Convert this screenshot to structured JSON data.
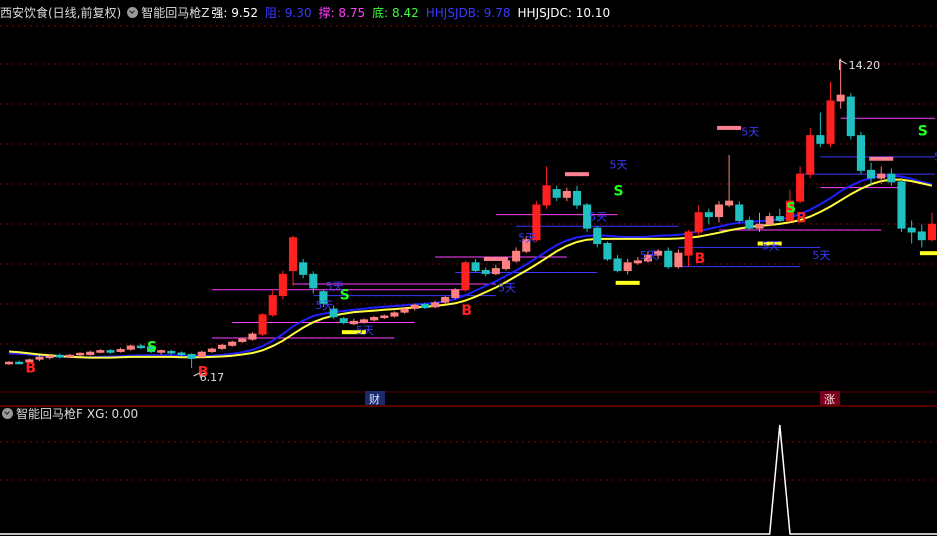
{
  "header_main": {
    "title": "西安饮食(日线,前复权)",
    "indicator": "智能回马枪Z",
    "items": [
      {
        "label": "强:",
        "value": "9.52",
        "color": "#ffffff"
      },
      {
        "label": "阻:",
        "value": "9.30",
        "color": "#3a3aff"
      },
      {
        "label": "撑:",
        "value": "8.75",
        "color": "#ff40ff"
      },
      {
        "label": "底:",
        "value": "8.42",
        "color": "#40ff40"
      },
      {
        "label": "HHJSJDB:",
        "value": "9.78",
        "color": "#3a3aff"
      },
      {
        "label": "HHJSJDC:",
        "value": "10.10",
        "color": "#ffffff"
      }
    ]
  },
  "header_sub": {
    "indicator": "智能回马枪F",
    "xg_label": "XG:",
    "xg_value": "0.00"
  },
  "annotations": {
    "high_price": "14.20",
    "low_price": "6.17",
    "tag_cai": "财",
    "tag_zhang": "涨",
    "signal_b": "B",
    "signal_s": "S",
    "day_label": "5天"
  },
  "colors": {
    "up": "#ff2020",
    "up_light": "#ff8080",
    "down": "#20c0c0",
    "ma_blue": "#2020ff",
    "ma_yellow": "#ffff40",
    "grid": "#8b0000"
  },
  "chart_data": {
    "type": "candlestick",
    "ylim": [
      5.6,
      15.2
    ],
    "candles": [
      [
        6.28,
        6.32,
        6.35,
        6.25
      ],
      [
        6.32,
        6.3,
        6.36,
        6.27
      ],
      [
        6.33,
        6.38,
        6.42,
        6.3
      ],
      [
        6.4,
        6.45,
        6.5,
        6.35
      ],
      [
        6.44,
        6.48,
        6.52,
        6.4
      ],
      [
        6.5,
        6.46,
        6.55,
        6.42
      ],
      [
        6.46,
        6.5,
        6.54,
        6.43
      ],
      [
        6.52,
        6.55,
        6.58,
        6.48
      ],
      [
        6.52,
        6.58,
        6.62,
        6.49
      ],
      [
        6.58,
        6.62,
        6.66,
        6.55
      ],
      [
        6.62,
        6.58,
        6.66,
        6.54
      ],
      [
        6.6,
        6.65,
        6.7,
        6.57
      ],
      [
        6.66,
        6.74,
        6.78,
        6.62
      ],
      [
        6.74,
        6.7,
        6.8,
        6.66
      ],
      [
        6.72,
        6.6,
        6.74,
        6.56
      ],
      [
        6.58,
        6.62,
        6.65,
        6.52
      ],
      [
        6.6,
        6.56,
        6.64,
        6.52
      ],
      [
        6.56,
        6.52,
        6.6,
        6.48
      ],
      [
        6.52,
        6.42,
        6.55,
        6.17
      ],
      [
        6.46,
        6.58,
        6.62,
        6.44
      ],
      [
        6.6,
        6.66,
        6.7,
        6.56
      ],
      [
        6.68,
        6.76,
        6.8,
        6.64
      ],
      [
        6.76,
        6.84,
        6.88,
        6.72
      ],
      [
        6.86,
        6.92,
        6.96,
        6.82
      ],
      [
        6.92,
        7.05,
        7.1,
        6.88
      ],
      [
        7.05,
        7.55,
        7.6,
        7.0
      ],
      [
        7.55,
        8.05,
        8.2,
        7.5
      ],
      [
        8.05,
        8.6,
        8.7,
        7.95
      ],
      [
        8.7,
        9.55,
        9.6,
        8.3
      ],
      [
        8.9,
        8.6,
        9.0,
        8.5
      ],
      [
        8.6,
        8.25,
        8.68,
        8.1
      ],
      [
        8.15,
        7.85,
        8.2,
        7.75
      ],
      [
        7.7,
        7.5,
        7.8,
        7.45
      ],
      [
        7.45,
        7.35,
        7.5,
        7.3
      ],
      [
        7.32,
        7.38,
        7.45,
        7.28
      ],
      [
        7.36,
        7.42,
        7.46,
        7.32
      ],
      [
        7.42,
        7.48,
        7.52,
        7.38
      ],
      [
        7.48,
        7.52,
        7.56,
        7.44
      ],
      [
        7.52,
        7.6,
        7.64,
        7.48
      ],
      [
        7.62,
        7.7,
        7.74,
        7.58
      ],
      [
        7.72,
        7.8,
        7.84,
        7.66
      ],
      [
        7.82,
        7.74,
        7.86,
        7.7
      ],
      [
        7.76,
        7.86,
        7.92,
        7.72
      ],
      [
        7.88,
        8.0,
        8.04,
        7.84
      ],
      [
        8.0,
        8.2,
        8.24,
        7.96
      ],
      [
        8.2,
        8.9,
        8.95,
        8.15
      ],
      [
        8.9,
        8.7,
        9.0,
        8.65
      ],
      [
        8.7,
        8.62,
        8.78,
        8.55
      ],
      [
        8.62,
        8.75,
        8.85,
        8.58
      ],
      [
        8.75,
        8.95,
        9.05,
        8.7
      ],
      [
        8.95,
        9.2,
        9.3,
        8.9
      ],
      [
        9.2,
        9.5,
        9.6,
        9.15
      ],
      [
        9.5,
        10.4,
        10.5,
        9.45
      ],
      [
        10.4,
        10.9,
        11.4,
        10.3
      ],
      [
        10.8,
        10.6,
        10.9,
        10.5
      ],
      [
        10.6,
        10.75,
        10.85,
        10.5
      ],
      [
        10.75,
        10.4,
        10.9,
        10.3
      ],
      [
        10.4,
        9.8,
        10.45,
        9.7
      ],
      [
        9.8,
        9.4,
        9.85,
        9.3
      ],
      [
        9.4,
        9.0,
        9.45,
        8.95
      ],
      [
        9.0,
        8.7,
        9.1,
        8.65
      ],
      [
        8.7,
        8.9,
        9.0,
        8.6
      ],
      [
        8.9,
        8.95,
        9.05,
        8.85
      ],
      [
        8.95,
        9.1,
        9.2,
        8.9
      ],
      [
        9.1,
        9.2,
        9.25,
        9.0
      ],
      [
        9.2,
        8.8,
        9.3,
        8.75
      ],
      [
        8.8,
        9.15,
        9.25,
        8.75
      ],
      [
        9.1,
        9.7,
        9.75,
        8.8
      ],
      [
        9.7,
        10.2,
        10.4,
        9.6
      ],
      [
        10.2,
        10.1,
        10.3,
        9.9
      ],
      [
        10.1,
        10.4,
        10.5,
        9.95
      ],
      [
        10.4,
        10.5,
        11.7,
        10.35
      ],
      [
        10.4,
        10.0,
        10.5,
        9.95
      ],
      [
        10.0,
        9.8,
        10.1,
        9.75
      ],
      [
        9.8,
        9.9,
        10.2,
        9.7
      ],
      [
        9.9,
        10.1,
        10.2,
        9.85
      ],
      [
        10.1,
        10.0,
        10.3,
        9.95
      ],
      [
        10.0,
        10.5,
        10.8,
        9.95
      ],
      [
        10.5,
        11.2,
        11.4,
        10.45
      ],
      [
        11.2,
        12.2,
        12.4,
        11.1
      ],
      [
        12.2,
        12.0,
        12.8,
        11.9
      ],
      [
        12.0,
        13.1,
        13.6,
        11.9
      ],
      [
        13.1,
        13.25,
        14.2,
        12.9
      ],
      [
        13.2,
        12.2,
        13.3,
        12.1
      ],
      [
        12.2,
        11.3,
        12.3,
        11.2
      ],
      [
        11.3,
        11.1,
        11.5,
        10.9
      ],
      [
        11.1,
        11.2,
        11.4,
        10.95
      ],
      [
        11.2,
        11.0,
        11.35,
        10.9
      ],
      [
        11.0,
        9.8,
        11.1,
        9.7
      ],
      [
        9.8,
        9.7,
        10.0,
        9.4
      ],
      [
        9.7,
        9.5,
        9.9,
        9.3
      ],
      [
        9.5,
        9.9,
        10.2,
        9.45
      ]
    ],
    "ma_blue": [
      6.55,
      6.54,
      6.52,
      6.5,
      6.48,
      6.47,
      6.46,
      6.45,
      6.45,
      6.46,
      6.47,
      6.48,
      6.49,
      6.5,
      6.5,
      6.5,
      6.5,
      6.49,
      6.48,
      6.48,
      6.49,
      6.51,
      6.54,
      6.58,
      6.64,
      6.74,
      6.88,
      7.05,
      7.25,
      7.4,
      7.52,
      7.58,
      7.62,
      7.65,
      7.68,
      7.71,
      7.74,
      7.76,
      7.78,
      7.8,
      7.82,
      7.84,
      7.86,
      7.9,
      7.96,
      8.06,
      8.18,
      8.3,
      8.42,
      8.56,
      8.7,
      8.86,
      9.02,
      9.2,
      9.36,
      9.48,
      9.56,
      9.6,
      9.61,
      9.6,
      9.58,
      9.57,
      9.57,
      9.58,
      9.6,
      9.61,
      9.63,
      9.66,
      9.72,
      9.78,
      9.84,
      9.9,
      9.94,
      9.96,
      9.98,
      10.0,
      10.03,
      10.08,
      10.16,
      10.28,
      10.42,
      10.58,
      10.76,
      10.9,
      11.02,
      11.1,
      11.15,
      11.16,
      11.14,
      11.08,
      11.0,
      10.94
    ],
    "ma_yellow": [
      6.6,
      6.58,
      6.55,
      6.52,
      6.5,
      6.48,
      6.46,
      6.45,
      6.44,
      6.44,
      6.44,
      6.45,
      6.46,
      6.46,
      6.46,
      6.46,
      6.46,
      6.45,
      6.45,
      6.45,
      6.46,
      6.47,
      6.49,
      6.52,
      6.56,
      6.63,
      6.74,
      6.88,
      7.05,
      7.22,
      7.36,
      7.46,
      7.53,
      7.58,
      7.62,
      7.64,
      7.66,
      7.68,
      7.7,
      7.72,
      7.74,
      7.76,
      7.78,
      7.81,
      7.85,
      7.92,
      8.02,
      8.14,
      8.26,
      8.4,
      8.55,
      8.7,
      8.86,
      9.03,
      9.2,
      9.34,
      9.44,
      9.5,
      9.52,
      9.52,
      9.52,
      9.52,
      9.52,
      9.52,
      9.52,
      9.52,
      9.53,
      9.55,
      9.58,
      9.63,
      9.68,
      9.74,
      9.79,
      9.83,
      9.86,
      9.88,
      9.91,
      9.95,
      10.01,
      10.1,
      10.22,
      10.36,
      10.52,
      10.68,
      10.82,
      10.94,
      11.02,
      11.06,
      11.06,
      11.02,
      10.96,
      10.9
    ],
    "xg": [
      0,
      0,
      0,
      0,
      0,
      0,
      0,
      0,
      0,
      0,
      0,
      0,
      0,
      0,
      0,
      0,
      0,
      0,
      0,
      0,
      0,
      0,
      0,
      0,
      0,
      0,
      0,
      0,
      0,
      0,
      0,
      0,
      0,
      0,
      0,
      0,
      0,
      0,
      0,
      0,
      0,
      0,
      0,
      0,
      0,
      0,
      0,
      0,
      0,
      0,
      0,
      0,
      0,
      0,
      0,
      0,
      0,
      0,
      0,
      0,
      0,
      0,
      0,
      0,
      0,
      0,
      0,
      0,
      0,
      0,
      0,
      0,
      0,
      0,
      0,
      0,
      1,
      0,
      0,
      0,
      0,
      0,
      0,
      0,
      0,
      0,
      0,
      0,
      0,
      0,
      0,
      0
    ]
  }
}
